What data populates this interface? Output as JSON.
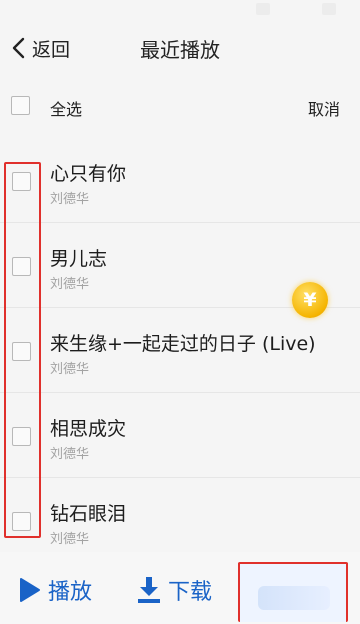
{
  "header": {
    "back_label": "返回",
    "title": "最近播放"
  },
  "select_bar": {
    "select_all_label": "全选",
    "cancel_label": "取消"
  },
  "songs": [
    {
      "title": "心只有你",
      "artist": "刘德华"
    },
    {
      "title": "男儿志",
      "artist": "刘德华"
    },
    {
      "title": "来生缘+一起走过的日子 (Live)",
      "artist": "刘德华"
    },
    {
      "title": "相思成灾",
      "artist": "刘德华"
    },
    {
      "title": "钻石眼泪",
      "artist": "刘德华"
    }
  ],
  "coin_badge": {
    "symbol": "¥"
  },
  "bottom_bar": {
    "play_label": "播放",
    "download_label": "下载"
  },
  "colors": {
    "accent": "#1a63c7",
    "highlight": "#e0302c",
    "coin": "#f5b400"
  },
  "icons": {
    "back": "chevron-left-icon",
    "play": "play-icon",
    "download": "download-icon",
    "coin": "coin-icon"
  }
}
